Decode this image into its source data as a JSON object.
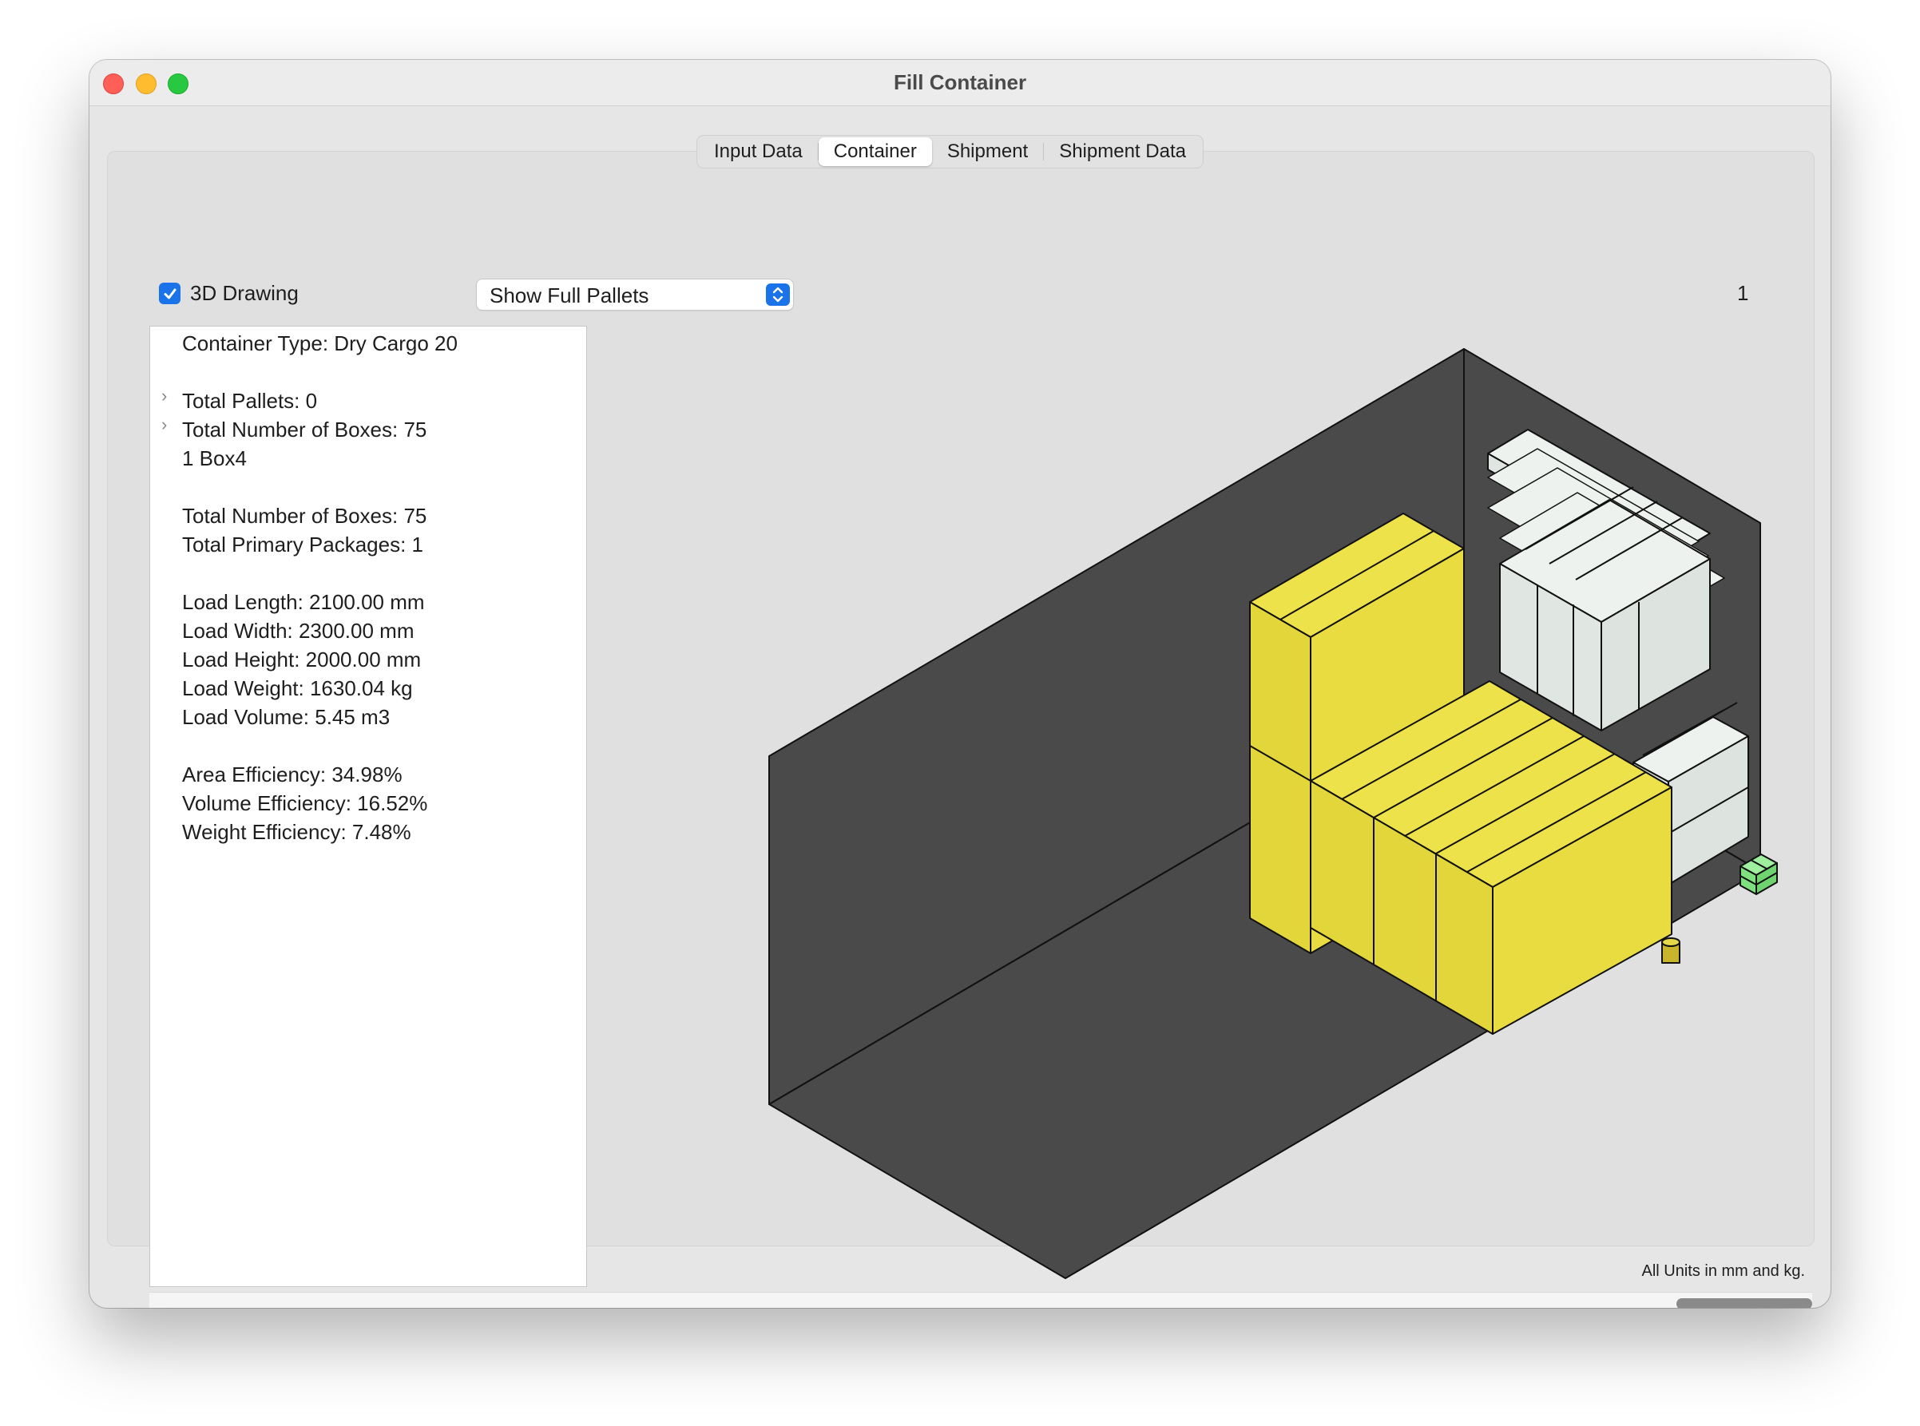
{
  "window": {
    "title": "Fill Container"
  },
  "tabs": [
    {
      "label": "Input Data",
      "active": false
    },
    {
      "label": "Container",
      "active": true
    },
    {
      "label": "Shipment",
      "active": false
    },
    {
      "label": "Shipment Data",
      "active": false
    }
  ],
  "toolbar": {
    "drawing_3d_label": "3D Drawing",
    "drawing_3d_checked": true,
    "display_mode": "Show Full Pallets",
    "page_number": "1"
  },
  "info": {
    "container_type": "Container Type: Dry Cargo 20",
    "total_pallets": "Total Pallets: 0",
    "total_boxes_expandable": "Total Number of Boxes: 75",
    "box_type": "1 Box4",
    "total_boxes": "Total Number of Boxes: 75",
    "total_primary": "Total Primary Packages: 1",
    "load_length": "Load Length: 2100.00 mm",
    "load_width": "Load Width: 2300.00 mm",
    "load_height": "Load Height: 2000.00 mm",
    "load_weight": "Load Weight: 1630.04 kg",
    "load_volume": "Load Volume: 5.45 m3",
    "area_efficiency": "Area Efficiency: 34.98%",
    "volume_efficiency": "Volume Efficiency: 16.52%",
    "weight_efficiency": "Weight Efficiency: 7.48%"
  },
  "footer": {
    "units_note": "All Units in mm and kg."
  },
  "colors": {
    "container_dark": "#4a4a4a",
    "box_yellow": "#e6dc3c",
    "box_grey": "#e0e6e2",
    "box_green": "#7ee07e",
    "accent_blue": "#1a73e8"
  }
}
